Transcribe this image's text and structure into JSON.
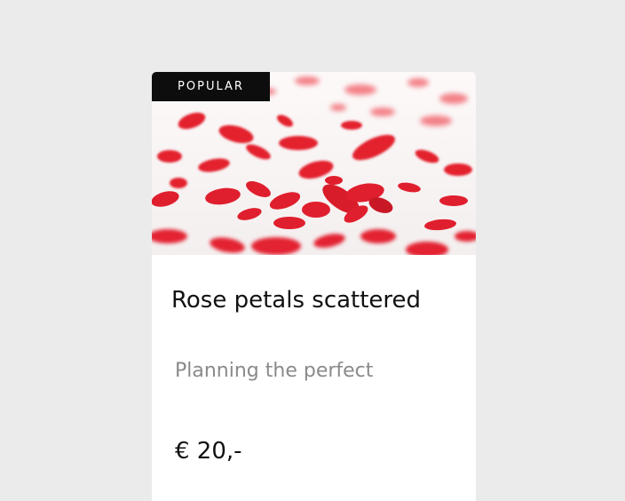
{
  "product": {
    "badge": "POPULAR",
    "title": "Rose petals scattered",
    "subtitle": "Planning the perfect",
    "price": "€ 20,-",
    "image": "rose-petals-photo"
  },
  "colors": {
    "page_background": "#ebebeb",
    "card_background": "#ffffff",
    "badge_background": "#0d0d0d",
    "petal_red": "#e01f2e",
    "subtitle_gray": "#8a8a8a"
  }
}
